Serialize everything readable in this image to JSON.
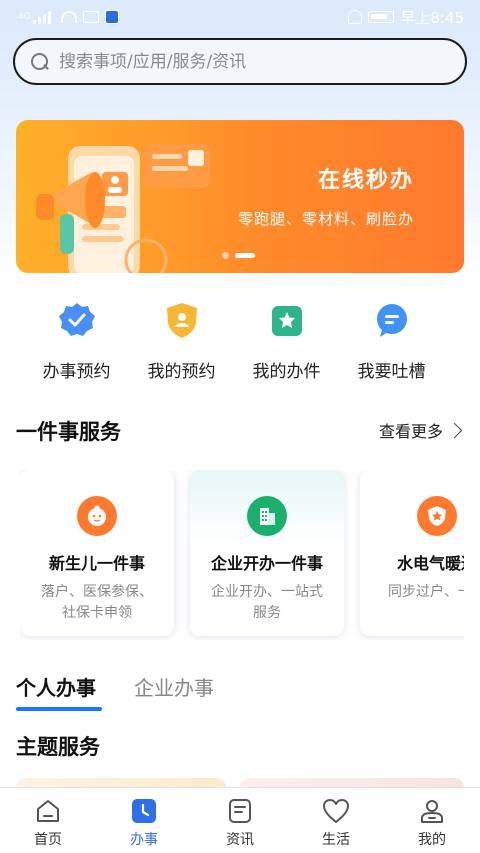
{
  "status_bar": {
    "time": "早上8:45",
    "network": "4G"
  },
  "search": {
    "placeholder": "搜索事项/应用/服务/资讯"
  },
  "banner": {
    "title": "在线秒办",
    "subtitle": "零跑腿、零材料、刷脸办",
    "slides": 2,
    "active_slide": 1
  },
  "quick_actions": [
    {
      "label": "办事预约",
      "icon": "verified-badge-icon"
    },
    {
      "label": "我的预约",
      "icon": "user-shield-icon"
    },
    {
      "label": "我的办件",
      "icon": "star-folder-icon"
    },
    {
      "label": "我要吐槽",
      "icon": "chat-bubble-icon"
    }
  ],
  "one_thing": {
    "title": "一件事服务",
    "more": "查看更多",
    "cards": [
      {
        "title": "新生儿一件事",
        "desc": "落户、医保参保、社保卡申领",
        "icon": "baby-icon",
        "color": "#ff7a2e"
      },
      {
        "title": "企业开办一件事",
        "desc": "企业开办、一站式服务",
        "icon": "building-icon",
        "color": "#19b06b"
      },
      {
        "title": "水电气暖过",
        "desc": "同步过户、一成",
        "icon": "star-badge-icon",
        "color": "#ff7a2e"
      }
    ]
  },
  "tabs": {
    "personal": "个人办事",
    "business": "企业办事"
  },
  "theme": {
    "title": "主题服务"
  },
  "bottom_nav": [
    {
      "label": "首页",
      "icon": "home-icon",
      "active": false
    },
    {
      "label": "办事",
      "icon": "clock-icon",
      "active": true
    },
    {
      "label": "资讯",
      "icon": "news-icon",
      "active": false
    },
    {
      "label": "生活",
      "icon": "heart-icon",
      "active": false
    },
    {
      "label": "我的",
      "icon": "user-icon",
      "active": false
    }
  ],
  "colors": {
    "accent": "#2f6fe8",
    "banner_orange": "#ff8a2a",
    "tab_underline": "#1677ff"
  }
}
